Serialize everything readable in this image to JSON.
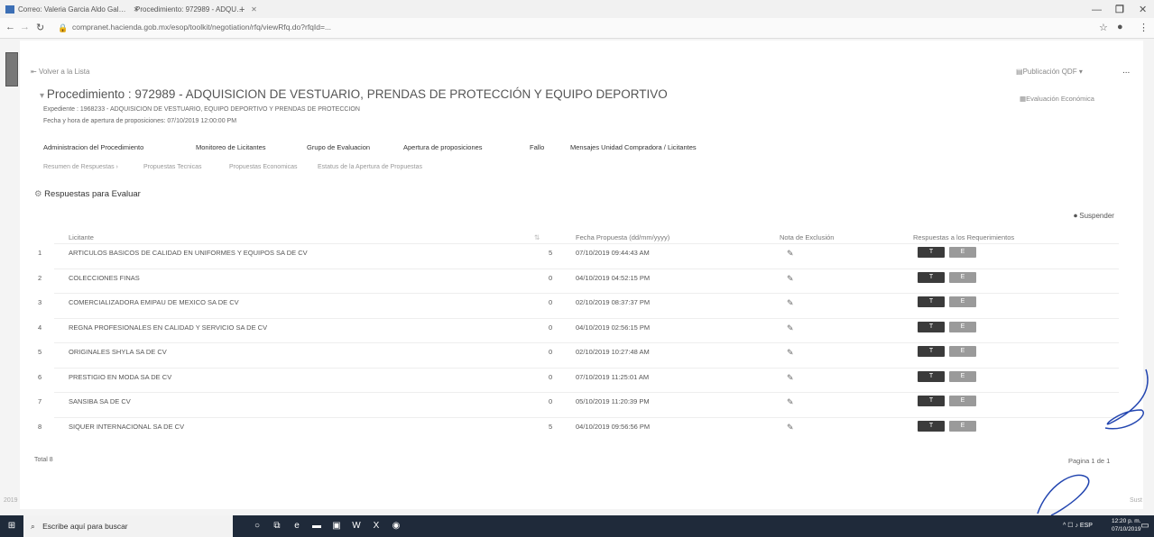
{
  "browser": {
    "tabs": [
      {
        "label": "Correo: Valeria Garcia Aldo Gal…"
      },
      {
        "label": "Procedimiento: 972989 - ADQU…"
      }
    ],
    "new_tab": "+",
    "url": "compranet.hacienda.gob.mx/esop/toolkit/negotiation/rfq/viewRfq.do?rfqId=..."
  },
  "header": {
    "back_link": "Volver a la Lista",
    "publication_button": "Publicación QDF",
    "more": "...",
    "title": "Procedimiento : 972989 - ADQUISICION DE VESTUARIO, PRENDAS DE PROTECCIÓN Y EQUIPO DEPORTIVO",
    "expediente": "Expediente : 1968233 - ADQUISICION DE VESTUARIO, EQUIPO DEPORTIVO Y PRENDAS DE PROTECCION",
    "fecha_apertura": "Fecha y hora de apertura de proposiciones: 07/10/2019 12:00:00 PM",
    "economic_eval": "Evaluación Económica"
  },
  "nav_primary": [
    "Administracion del Procedimiento",
    "Monitoreo de Licitantes",
    "Grupo de Evaluacion",
    "Apertura de proposiciones",
    "Fallo",
    "Mensajes Unidad Compradora / Licitantes"
  ],
  "nav_secondary": [
    "Resumen de Respuestas",
    "Propuestas Tecnicas",
    "Propuestas Economicas",
    "Estatus de la Apertura de Propuestas"
  ],
  "section_title": "Respuestas para Evaluar",
  "suspend_label": "Suspender",
  "table": {
    "headers": [
      "Licitante",
      "Fecha Propuesta (dd/mm/yyyy)",
      "Nota de Exclusión",
      "Respuestas a los Requerimientos"
    ],
    "rows": [
      {
        "n": "1",
        "licitante": "ARTICULOS BASICOS DE CALIDAD EN UNIFORMES Y EQUIPOS SA DE CV",
        "v": "5",
        "fecha": "07/10/2019 09:44:43 AM"
      },
      {
        "n": "2",
        "licitante": "COLECCIONES FINAS",
        "v": "0",
        "fecha": "04/10/2019 04:52:15 PM"
      },
      {
        "n": "3",
        "licitante": "COMERCIALIZADORA EMIPAU DE MEXICO SA DE CV",
        "v": "0",
        "fecha": "02/10/2019 08:37:37 PM"
      },
      {
        "n": "4",
        "licitante": "REGNA PROFESIONALES EN CALIDAD Y SERVICIO SA DE CV",
        "v": "0",
        "fecha": "04/10/2019 02:56:15 PM"
      },
      {
        "n": "5",
        "licitante": "ORIGINALES SHYLA SA DE CV",
        "v": "0",
        "fecha": "02/10/2019 10:27:48 AM"
      },
      {
        "n": "6",
        "licitante": "PRESTIGIO EN MODA SA DE CV",
        "v": "0",
        "fecha": "07/10/2019 11:25:01 AM"
      },
      {
        "n": "7",
        "licitante": "SANSIBA SA DE CV",
        "v": "0",
        "fecha": "05/10/2019 11:20:39 PM"
      },
      {
        "n": "8",
        "licitante": "SIQUER INTERNACIONAL SA DE CV",
        "v": "5",
        "fecha": "04/10/2019 09:56:56 PM"
      }
    ],
    "btn_t": "T",
    "btn_e": "E",
    "total": "Total 8",
    "pagination": "Pagina 1 de 1"
  },
  "footer": {
    "left": "2019",
    "right": "Sust"
  },
  "taskbar": {
    "search_placeholder": "Escribe aquí para buscar",
    "lang": "ESP",
    "time": "12:20 p. m.",
    "date": "07/10/2019"
  }
}
